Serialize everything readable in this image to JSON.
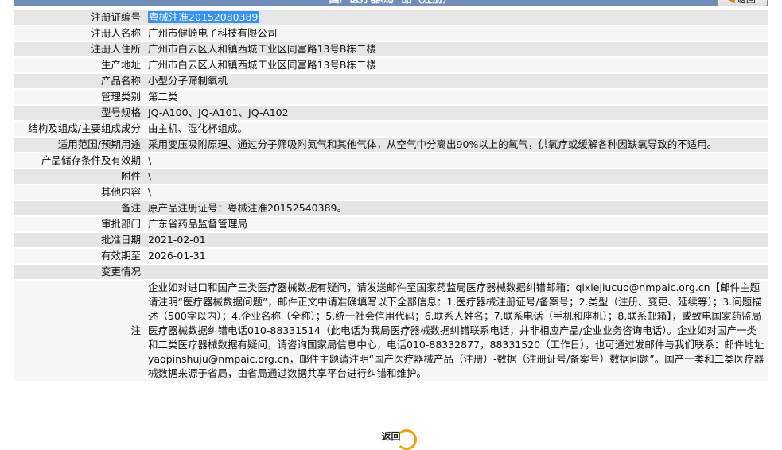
{
  "header": {
    "title": "国产医疗器械产品（注册）",
    "back_top_label": "返回"
  },
  "rows": [
    {
      "label": "注册证编号",
      "value": "粤械注准20152080389"
    },
    {
      "label": "注册人名称",
      "value": "广州市健崎电子科技有限公司"
    },
    {
      "label": "注册人住所",
      "value": "广州市白云区人和镇西城工业区同富路13号B栋二楼"
    },
    {
      "label": "生产地址",
      "value": "广州市白云区人和镇西城工业区同富路13号B栋二楼"
    },
    {
      "label": "产品名称",
      "value": "小型分子筛制氧机"
    },
    {
      "label": "管理类别",
      "value": "第二类"
    },
    {
      "label": "型号规格",
      "value": "JQ-A100、JQ-A101、JQ-A102"
    },
    {
      "label": "结构及组成/主要组成成分",
      "value": "由主机、湿化杯组成。"
    },
    {
      "label": "适用范围/预期用途",
      "value": "采用变压吸附原理、通过分子筛吸附氮气和其他气体，从空气中分离出90%以上的氧气，供氧疗或缓解各种因缺氧导致的不适用。"
    },
    {
      "label": "产品储存条件及有效期",
      "value": "\\"
    },
    {
      "label": "附件",
      "value": "\\"
    },
    {
      "label": "其他内容",
      "value": "\\"
    },
    {
      "label": "备注",
      "value": "原产品注册证号：粤械注准20152540389。"
    },
    {
      "label": "审批部门",
      "value": "广东省药品监督管理局"
    },
    {
      "label": "批准日期",
      "value": "2021-02-01"
    },
    {
      "label": "有效期至",
      "value": "2026-01-31"
    },
    {
      "label": "变更情况",
      "value": ""
    }
  ],
  "notes": {
    "label": "注",
    "text": "企业如对进口和国产三类医疗器械数据有疑问，请发送邮件至国家药监局医疗器械数据纠错邮箱：qixiejiucuo@nmpaic.org.cn【邮件主题请注明“医疗器械数据问题”，邮件正文中请准确填写以下全部信息：1.医疗器械注册证号/备案号；2.类型（注册、变更、延续等）；3.问题描述（500字以内）；4.企业名称（全称）；5.统一社会信用代码；6.联系人姓名；7.联系电话（手机和座机）；8.联系邮箱】，或致电国家药监局医疗器械数据纠错电话010-88331514（此电话为我局医疗器械数据纠错联系电话，并非相应产品/企业业务咨询电话）。企业如对国产一类和二类医疗器械数据有疑问，请咨询国家局信息中心，电话010-88332877，88331520（工作日），也可通过发邮件与我们联系：邮件地址yaopinshuju@nmpaic.org.cn，邮件主题请注明“国产医疗器械产品（注册）-数据（注册证号/备案号）数据问题”。国产一类和二类医疗器械数据来源于省局，由省局通过数据共享平台进行纠错和维护。"
  },
  "footer": {
    "back_label": "返回"
  },
  "colors": {
    "header_bg": "#6e8eb9",
    "row_odd": "#e6e6e6",
    "row_even": "#f7f7f7",
    "selection": "#3390ff",
    "back_ring": "#f0a000"
  }
}
